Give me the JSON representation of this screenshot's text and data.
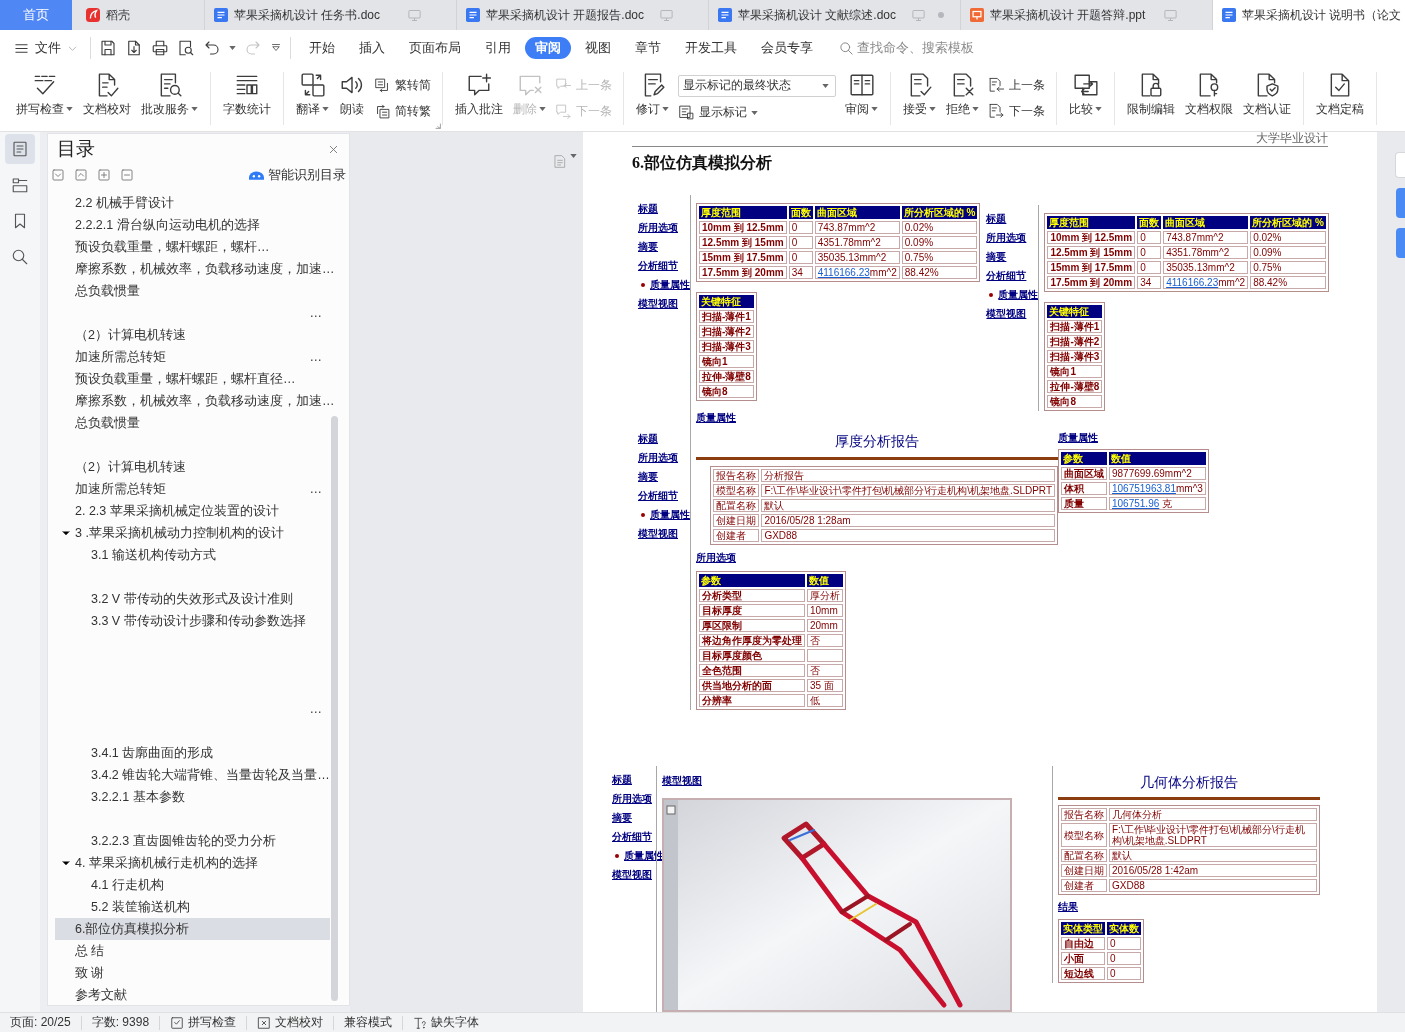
{
  "tabs": [
    {
      "kind": "home",
      "label": "首页",
      "selected": false
    },
    {
      "kind": "docer",
      "label": "稻壳",
      "selected": false
    },
    {
      "kind": "word",
      "label": "苹果采摘机设计 任务书.doc",
      "selected": false,
      "modified": false
    },
    {
      "kind": "word",
      "label": "苹果采摘机设计 开题报告.doc",
      "selected": false,
      "modified": false
    },
    {
      "kind": "word",
      "label": "苹果采摘机设计 文献综述.doc",
      "selected": false,
      "modified": true
    },
    {
      "kind": "ppt",
      "label": "苹果采摘机设计 开题答辩.ppt",
      "selected": false,
      "modified": false
    },
    {
      "kind": "word",
      "label": "苹果采摘机设计 说明书（论文",
      "selected": true,
      "modified": false
    }
  ],
  "menu": {
    "file": "文件",
    "tabs": [
      {
        "label": "开始",
        "selected": false
      },
      {
        "label": "插入",
        "selected": false
      },
      {
        "label": "页面布局",
        "selected": false
      },
      {
        "label": "引用",
        "selected": false
      },
      {
        "label": "审阅",
        "selected": true
      },
      {
        "label": "视图",
        "selected": false
      },
      {
        "label": "章节",
        "selected": false
      },
      {
        "label": "开发工具",
        "selected": false
      },
      {
        "label": "会员专享",
        "selected": false
      }
    ],
    "search": {
      "placeholder": "查找命令、搜索模板"
    }
  },
  "quick_access": [
    {
      "disabled": false
    },
    {
      "disabled": false
    },
    {
      "disabled": false
    },
    {
      "disabled": false
    },
    {
      "disabled": false
    },
    {
      "disabled": true
    },
    {
      "disabled": false
    }
  ],
  "ribbon": [
    {
      "launcher": false,
      "items": [
        {
          "kind": "large",
          "label": "拼写检查",
          "dropdown": true,
          "disabled": false
        },
        {
          "kind": "large",
          "label": "文档校对",
          "dropdown": false,
          "disabled": false
        },
        {
          "kind": "large",
          "label": "批改服务",
          "dropdown": true,
          "disabled": false
        }
      ]
    },
    {
      "launcher": false,
      "items": [
        {
          "kind": "large",
          "label": "字数统计",
          "dropdown": false,
          "disabled": false
        }
      ]
    },
    {
      "launcher": true,
      "items": [
        {
          "kind": "large",
          "label": "翻译",
          "dropdown": true,
          "disabled": false
        },
        {
          "kind": "large",
          "label": "朗读",
          "dropdown": false,
          "disabled": false
        },
        {
          "kind": "stack",
          "buttons": [
            {
              "label": "繁转简",
              "dropdown": false,
              "disabled": false
            },
            {
              "label": "简转繁",
              "dropdown": false,
              "disabled": false
            }
          ]
        }
      ]
    },
    {
      "launcher": false,
      "items": [
        {
          "kind": "large",
          "label": "插入批注",
          "dropdown": false,
          "disabled": false
        },
        {
          "kind": "large",
          "label": "删除",
          "dropdown": true,
          "disabled": true
        },
        {
          "kind": "stack",
          "buttons": [
            {
              "label": "上一条",
              "dropdown": false,
              "disabled": true
            },
            {
              "label": "下一条",
              "dropdown": false,
              "disabled": true
            }
          ]
        }
      ]
    },
    {
      "launcher": false,
      "items": [
        {
          "kind": "large",
          "label": "修订",
          "dropdown": true,
          "disabled": false
        },
        {
          "kind": "markup",
          "select": {
            "value": "显示标记的最终状态"
          },
          "button": {
            "label": "显示标记",
            "dropdown": true,
            "disabled": false
          }
        },
        {
          "kind": "large",
          "label": "审阅",
          "dropdown": true,
          "disabled": false
        }
      ]
    },
    {
      "launcher": false,
      "items": [
        {
          "kind": "large",
          "label": "接受",
          "dropdown": true,
          "disabled": false
        },
        {
          "kind": "large",
          "label": "拒绝",
          "dropdown": true,
          "disabled": false
        },
        {
          "kind": "stack",
          "buttons": [
            {
              "label": "上一条",
              "dropdown": false,
              "disabled": false
            },
            {
              "label": "下一条",
              "dropdown": false,
              "disabled": false
            }
          ]
        }
      ]
    },
    {
      "launcher": false,
      "items": [
        {
          "kind": "large",
          "label": "比较",
          "dropdown": true,
          "disabled": false
        }
      ]
    },
    {
      "launcher": false,
      "items": [
        {
          "kind": "large",
          "label": "限制编辑",
          "dropdown": false,
          "disabled": false
        },
        {
          "kind": "large",
          "label": "文档权限",
          "dropdown": false,
          "disabled": false
        },
        {
          "kind": "large",
          "label": "文档认证",
          "dropdown": false,
          "disabled": false
        }
      ]
    },
    {
      "launcher": false,
      "items": [
        {
          "kind": "large",
          "label": "文档定稿",
          "dropdown": false,
          "disabled": false
        }
      ]
    }
  ],
  "sidebar": [
    {
      "selected": true
    },
    {
      "selected": false
    },
    {
      "selected": false
    },
    {
      "selected": false
    }
  ],
  "outline": {
    "title": "目录",
    "smart_button": "智能识别目录",
    "entries": [
      {
        "kind": "entry",
        "label": "2.2 机械手臂设计",
        "selected": false
      },
      {
        "kind": "entry",
        "label": "2.2.2.1 滑台纵向运动电机的选择",
        "selected": false
      },
      {
        "kind": "entry",
        "label": "预设负载重量，螺杆螺距，螺杆…",
        "selected": false
      },
      {
        "kind": "entry",
        "label": "摩擦系数，机械效率，负载移动速度，加速…",
        "selected": false
      },
      {
        "kind": "entry",
        "label": "总负载惯量",
        "selected": false
      },
      {
        "kind": "entry",
        "overflow": "…",
        "selected": false
      },
      {
        "kind": "entry",
        "label": "（2）计算电机转速",
        "selected": false
      },
      {
        "kind": "entry",
        "label": "加速所需总转矩",
        "overflow": "…",
        "selected": false
      },
      {
        "kind": "entry",
        "label": "预设负载重量，螺杆螺距，螺杆直径…",
        "selected": false
      },
      {
        "kind": "entry",
        "label": "摩擦系数，机械效率，负载移动速度，加速…",
        "selected": false
      },
      {
        "kind": "entry",
        "label": "总负载惯量",
        "selected": false
      },
      {
        "kind": "blank",
        "selected": false
      },
      {
        "kind": "entry",
        "label": "（2）计算电机转速",
        "selected": false
      },
      {
        "kind": "entry",
        "label": "加速所需总转矩",
        "overflow": "…",
        "selected": false
      },
      {
        "kind": "entry",
        "label": "2. 2.3 苹果采摘机械定位装置的设计",
        "selected": false
      },
      {
        "kind": "entry",
        "label": "3 .苹果采摘机械动力控制机构的设计",
        "selected": false,
        "expanded": true,
        "children": [
          {
            "kind": "entry",
            "label": "3.1 输送机构传动方式",
            "selected": false
          },
          {
            "kind": "blank",
            "selected": false
          },
          {
            "kind": "entry",
            "label": "3.2 V 带传动的失效形式及设计准则",
            "selected": false
          },
          {
            "kind": "entry",
            "label": "3.3 V 带传动设计步骤和传动参数选择",
            "selected": false
          },
          {
            "kind": "blank",
            "selected": false
          },
          {
            "kind": "blank",
            "selected": false
          },
          {
            "kind": "blank",
            "selected": false
          },
          {
            "kind": "entry",
            "overflow": "…",
            "selected": false
          },
          {
            "kind": "blank",
            "selected": false
          },
          {
            "kind": "entry",
            "label": "3.4.1 齿廓曲面的形成",
            "selected": false
          },
          {
            "kind": "entry",
            "label": "3.4.2 锥齿轮大端背锥、当量齿轮及当量…",
            "selected": false
          },
          {
            "kind": "entry",
            "label": "3.2.2.1 基本参数",
            "selected": false
          },
          {
            "kind": "blank",
            "selected": false
          },
          {
            "kind": "entry",
            "label": "3.2.2.3 直齿圆锥齿轮的受力分析",
            "selected": false
          }
        ]
      },
      {
        "kind": "entry",
        "label": "4. 苹果采摘机械行走机构的选择",
        "selected": false,
        "expanded": true,
        "children": [
          {
            "kind": "entry",
            "label": "4.1 行走机构",
            "selected": false
          },
          {
            "kind": "entry",
            "label": "5.2 装筐输送机构",
            "selected": false
          }
        ]
      },
      {
        "kind": "entry",
        "label": "6.部位仿真模拟分析",
        "selected": true
      },
      {
        "kind": "entry",
        "label": "总 结",
        "selected": false
      },
      {
        "kind": "entry",
        "label": "致 谢",
        "selected": false
      },
      {
        "kind": "entry",
        "label": "参考文献",
        "selected": false
      }
    ]
  },
  "document": {
    "header": "大学毕业设计",
    "heading": "6.部位仿真模拟分析",
    "rows": [
      [
        {
          "kind": "summary",
          "nav": [
            {
              "label": "标题",
              "selected": false
            },
            {
              "label": "所用选项",
              "selected": false
            },
            {
              "label": "摘要",
              "selected": false
            },
            {
              "label": "分析细节",
              "selected": false
            },
            {
              "label": "质量属性",
              "selected": true
            },
            {
              "label": "模型视图",
              "selected": false
            }
          ],
          "tables": [
            {
              "columns": [
                "厚度范围",
                "面数",
                "曲面区域",
                "所分析区域的 %"
              ],
              "rows": [
                [
                  "10mm 到 12.5mm",
                  "0",
                  "743.87mm^2",
                  "0.02%"
                ],
                [
                  "12.5mm 到 15mm",
                  "0",
                  "4351.78mm^2",
                  "0.09%"
                ],
                [
                  "15mm 到 17.5mm",
                  "0",
                  "35035.13mm^2",
                  "0.75%"
                ],
                [
                  "17.5mm 到 20mm",
                  "34",
                  {
                    "link": "4116166.23",
                    "text": "mm^2"
                  },
                  "88.42%"
                ]
              ]
            },
            {
              "columns": [
                "关键特征"
              ],
              "rows": [
                [
                  "扫描-薄件1"
                ],
                [
                  "扫描-薄件2"
                ],
                [
                  "扫描-薄件3"
                ],
                [
                  "镜向1"
                ],
                [
                  "拉伸-薄壁8"
                ],
                [
                  "镜向8"
                ]
              ]
            }
          ],
          "footer": "质量属性"
        },
        {
          "kind": "summary",
          "nav": [
            {
              "label": "标题",
              "selected": false
            },
            {
              "label": "所用选项",
              "selected": false
            },
            {
              "label": "摘要",
              "selected": false
            },
            {
              "label": "分析细节",
              "selected": false
            },
            {
              "label": "质量属性",
              "selected": true
            },
            {
              "label": "模型视图",
              "selected": false
            }
          ],
          "tables": [
            {
              "columns": [
                "厚度范围",
                "面数",
                "曲面区域",
                "所分析区域的 %"
              ],
              "rows": [
                [
                  "10mm 到 12.5mm",
                  "0",
                  "743.87mm^2",
                  "0.02%"
                ],
                [
                  "12.5mm 到 15mm",
                  "0",
                  "4351.78mm^2",
                  "0.09%"
                ],
                [
                  "15mm 到 17.5mm",
                  "0",
                  "35035.13mm^2",
                  "0.75%"
                ],
                [
                  "17.5mm 到 20mm",
                  "34",
                  {
                    "link": "4116166.23",
                    "text": "mm^2"
                  },
                  "88.42%"
                ]
              ]
            },
            {
              "columns": [
                "关键特征"
              ],
              "rows": [
                [
                  "扫描-薄件1"
                ],
                [
                  "扫描-薄件2"
                ],
                [
                  "扫描-薄件3"
                ],
                [
                  "镜向1"
                ],
                [
                  "拉伸-薄壁8"
                ],
                [
                  "镜向8"
                ]
              ]
            }
          ]
        }
      ],
      [
        {
          "kind": "report",
          "nav": [
            {
              "label": "标题",
              "selected": false
            },
            {
              "label": "所用选项",
              "selected": false
            },
            {
              "label": "摘要",
              "selected": false
            },
            {
              "label": "分析细节",
              "selected": false
            },
            {
              "label": "质量属性",
              "selected": true
            },
            {
              "label": "模型视图",
              "selected": false
            }
          ],
          "title": "厚度分析报告",
          "info": {
            "rows": [
              [
                "报告名称",
                "分析报告"
              ],
              [
                "模型名称",
                "F:\\工作\\毕业设计\\零件打包\\机械部分\\行走机构\\机架地盘.SLDPRT"
              ],
              [
                "配置名称",
                "默认"
              ],
              [
                "创建日期",
                "2016/05/28 1:28am"
              ],
              [
                "创建者",
                "GXD88"
              ]
            ]
          },
          "section": "所用选项",
          "tables": [
            {
              "columns": [
                "参数",
                "数值"
              ],
              "rows": [
                [
                  "分析类型",
                  "厚分析"
                ],
                [
                  "目标厚度",
                  "10mm"
                ],
                [
                  "厚区限制",
                  "20mm"
                ],
                [
                  "将边角作厚度为零处理",
                  "否"
                ],
                [
                  "目标厚度颜色"
                ],
                [
                  "全色范围",
                  "否"
                ],
                [
                  "供当地分析的面",
                  "35 面"
                ],
                [
                  "分辨率",
                  "低"
                ]
              ]
            }
          ],
          "side": {
            "heading": "质量属性",
            "table": {
              "columns": [
                "参数",
                "数值"
              ],
              "rows": [
                [
                  "曲面区域",
                  "9877699.69mm^2"
                ],
                [
                  "体积",
                  {
                    "link": "106751963.81",
                    "text": "mm^3"
                  }
                ],
                [
                  "质量",
                  {
                    "link": "106751.96",
                    "text": " 克"
                  }
                ]
              ]
            }
          }
        }
      ],
      [
        {
          "kind": "model_view",
          "nav": [
            {
              "label": "标题",
              "selected": false
            },
            {
              "label": "所用选项",
              "selected": false
            },
            {
              "label": "摘要",
              "selected": false
            },
            {
              "label": "分析细节",
              "selected": false
            },
            {
              "label": "质量属性",
              "selected": true
            },
            {
              "label": "模型视图",
              "selected": false
            }
          ],
          "heading": "模型视图"
        },
        {
          "kind": "report",
          "title": "几何体分析报告",
          "info": {
            "rows": [
              [
                "报告名称",
                "几何体分析"
              ],
              [
                "模型名称",
                "F:\\工作\\毕业设计\\零件打包\\机械部分\\行走机构\\机架地盘.SLDPRT"
              ],
              [
                "配置名称",
                "默认"
              ],
              [
                "创建日期",
                "2016/05/28 1:42am"
              ],
              [
                "创建者",
                "GXD88"
              ]
            ]
          },
          "section": "结果",
          "tables": [
            {
              "columns": [
                "实体类型",
                "实体数"
              ],
              "rows": [
                [
                  "自由边",
                  "0"
                ],
                [
                  "小面",
                  "0"
                ],
                [
                  "短边线",
                  "0"
                ]
              ]
            }
          ]
        }
      ]
    ]
  },
  "status_bar": {
    "items": [
      {
        "kind": "text",
        "label": "页面: 20/25"
      },
      {
        "kind": "text",
        "label": "字数: 9398"
      },
      {
        "kind": "button",
        "label": "拼写检查"
      },
      {
        "kind": "button",
        "label": "文档校对"
      },
      {
        "kind": "text",
        "label": "兼容模式"
      },
      {
        "kind": "button",
        "label": "缺失字体"
      }
    ]
  }
}
